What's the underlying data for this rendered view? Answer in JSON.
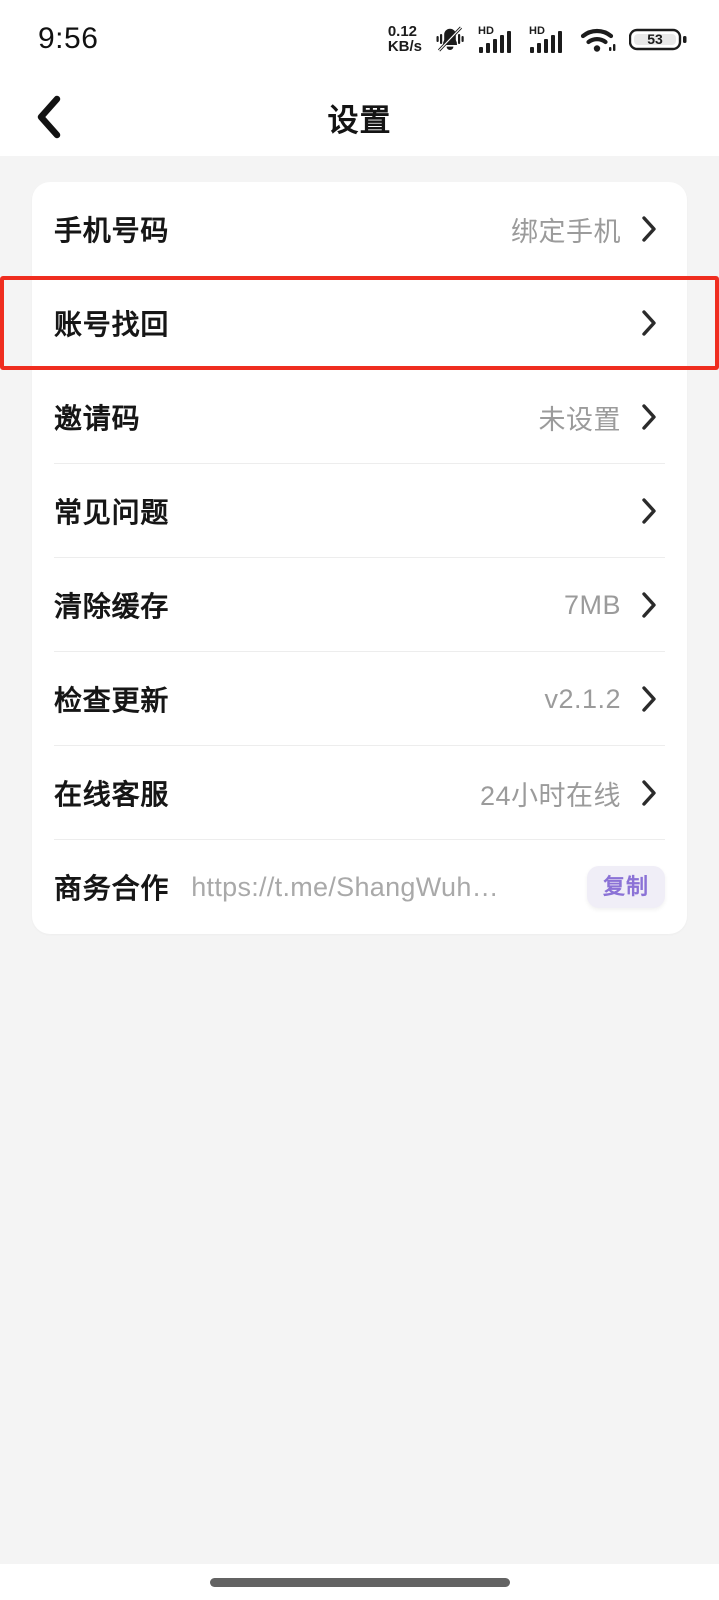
{
  "status_bar": {
    "time": "9:56",
    "net_speed_value": "0.12",
    "net_speed_unit": "KB/s",
    "icons": [
      "bell-muted-icon",
      "hd-signal-icon",
      "hd-signal-icon",
      "wifi-icon",
      "battery-icon"
    ],
    "battery_level": "53"
  },
  "nav": {
    "back_icon": "chevron-left-icon",
    "title": "设置"
  },
  "settings": {
    "rows": [
      {
        "label": "手机号码",
        "value": "绑定手机",
        "chevron": true,
        "divider": false
      },
      {
        "label": "账号找回",
        "value": "",
        "chevron": true,
        "divider": false
      },
      {
        "label": "邀请码",
        "value": "未设置",
        "chevron": true,
        "divider": true
      },
      {
        "label": "常见问题",
        "value": "",
        "chevron": true,
        "divider": true
      },
      {
        "label": "清除缓存",
        "value": "7MB",
        "chevron": true,
        "divider": true
      },
      {
        "label": "检查更新",
        "value": "v2.1.2",
        "chevron": true,
        "divider": true
      },
      {
        "label": "在线客服",
        "value": "24小时在线",
        "chevron": true,
        "divider": true
      },
      {
        "label": "商务合作",
        "url": "https://t.me/ShangWuh…",
        "copy_label": "复制",
        "chevron": false,
        "divider": false
      }
    ]
  },
  "highlight": {
    "target_row_label": "账号找回",
    "color": "#ef2d1f"
  },
  "colors": {
    "page_background": "#f4f4f4",
    "card_background": "#ffffff",
    "label_text": "#161616",
    "value_text": "#9b9b9b",
    "copy_button_background": "#f0eef7",
    "copy_button_text": "#8b72d6",
    "home_indicator": "#636363"
  }
}
